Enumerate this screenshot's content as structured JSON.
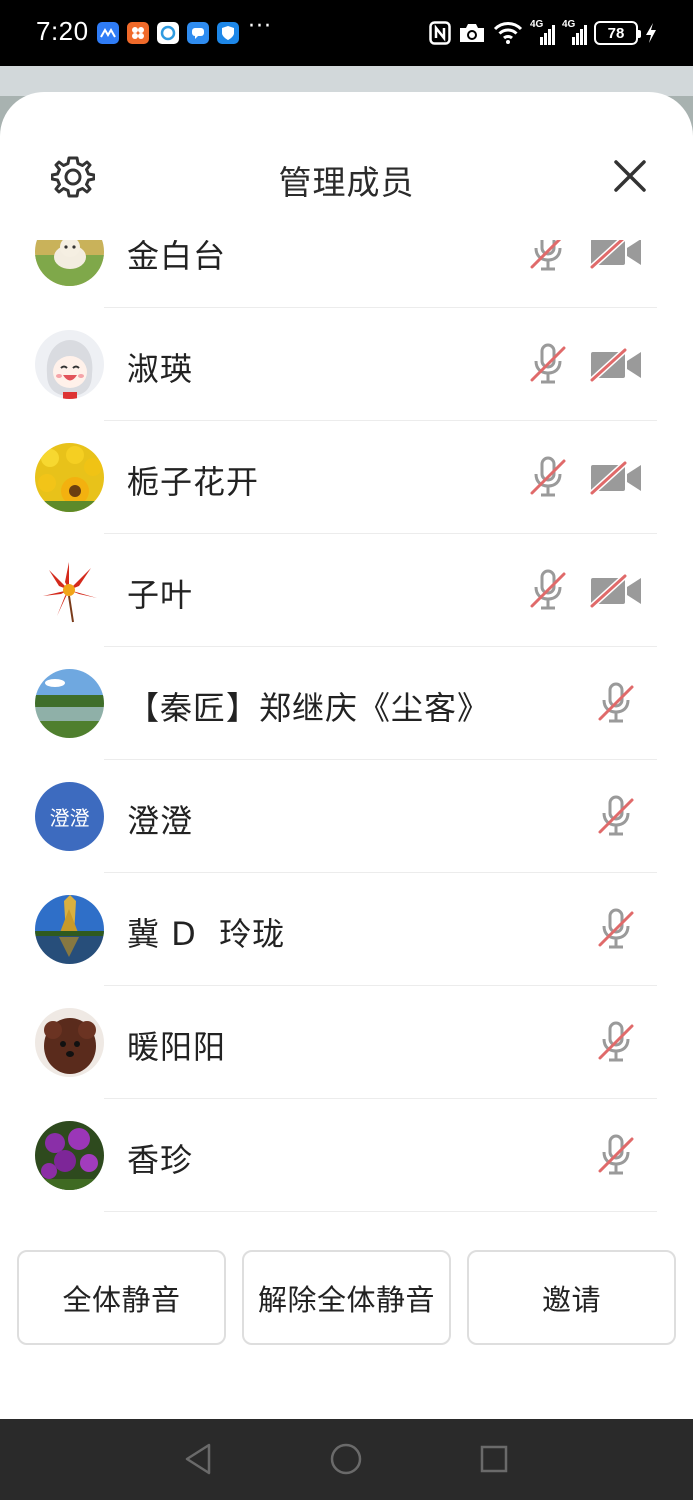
{
  "status_bar": {
    "time": "7:20",
    "battery": "78",
    "icons": [
      "app-icon",
      "app-icon",
      "app-icon",
      "app-icon",
      "app-icon",
      "more-icon",
      "nfc-icon",
      "camera-icon",
      "wifi-icon",
      "signal-4g-icon",
      "signal-4g-icon",
      "battery-icon",
      "charging-icon"
    ],
    "more": "···",
    "net_label_1": "4G",
    "net_label_2": "4G"
  },
  "sheet": {
    "title": "管理成员",
    "settings_icon": "gear-icon",
    "close_icon": "close-icon"
  },
  "members": [
    {
      "name": "金白台",
      "mic": "muted",
      "camera": "off"
    },
    {
      "name": "淑瑛",
      "mic": "muted",
      "camera": "off"
    },
    {
      "name": "栀子花开",
      "mic": "muted",
      "camera": "off"
    },
    {
      "name": "子叶",
      "mic": "muted",
      "camera": "off"
    },
    {
      "name": "【秦匠】郑继庆《尘客》",
      "mic": "muted"
    },
    {
      "name": "澄澄",
      "mic": "muted",
      "avatar_text": "澄澄"
    },
    {
      "name": "冀 D  玲珑",
      "mic": "muted"
    },
    {
      "name": "暖阳阳",
      "mic": "muted"
    },
    {
      "name": "香珍",
      "mic": "muted"
    }
  ],
  "footer": {
    "mute_all": "全体静音",
    "unmute_all": "解除全体静音",
    "invite": "邀请"
  },
  "navbar": {
    "back": "back-icon",
    "home": "home-icon",
    "recents": "recents-icon"
  },
  "colors": {
    "muted_slash": "#e06a6a",
    "icon_gray": "#9a9a9a",
    "avatar_blue": "#3d6bbf"
  }
}
